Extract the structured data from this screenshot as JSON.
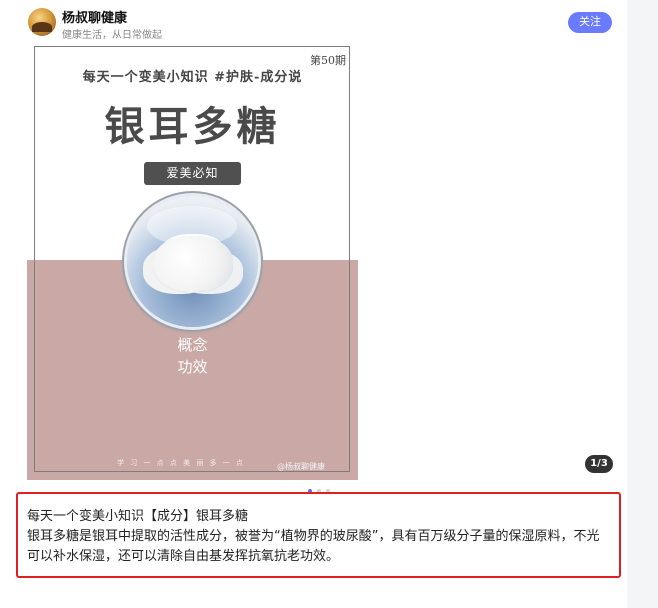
{
  "author": {
    "name": "杨叔聊健康",
    "bio": "健康生活，从日常做起"
  },
  "follow_label": "关注",
  "poster": {
    "issue": "第50期",
    "tagline": "每天一个变美小知识 #护肤-成分说",
    "title": "银耳多糖",
    "badge": "爱美必知",
    "concept_line1": "概念",
    "concept_line2": "功效",
    "footer": "学 习 一 点 点   美 丽 多 一 点",
    "watermark": "@杨叔聊健康"
  },
  "gallery": {
    "counter": "1/3",
    "total": 3,
    "active_index": 0
  },
  "caption": {
    "title": "每天一个变美小知识【成分】银耳多糖",
    "body": "银耳多糖是银耳中提取的活性成分，被誉为“植物界的玻尿酸”，具有百万级分子量的保湿原料，不光可以补水保湿，还可以清除自由基发挥抗氧抗老功效。"
  },
  "colors": {
    "accent": "#6b7bff",
    "poster_pink": "#c9a8a6",
    "highlight_border": "#e02020"
  }
}
